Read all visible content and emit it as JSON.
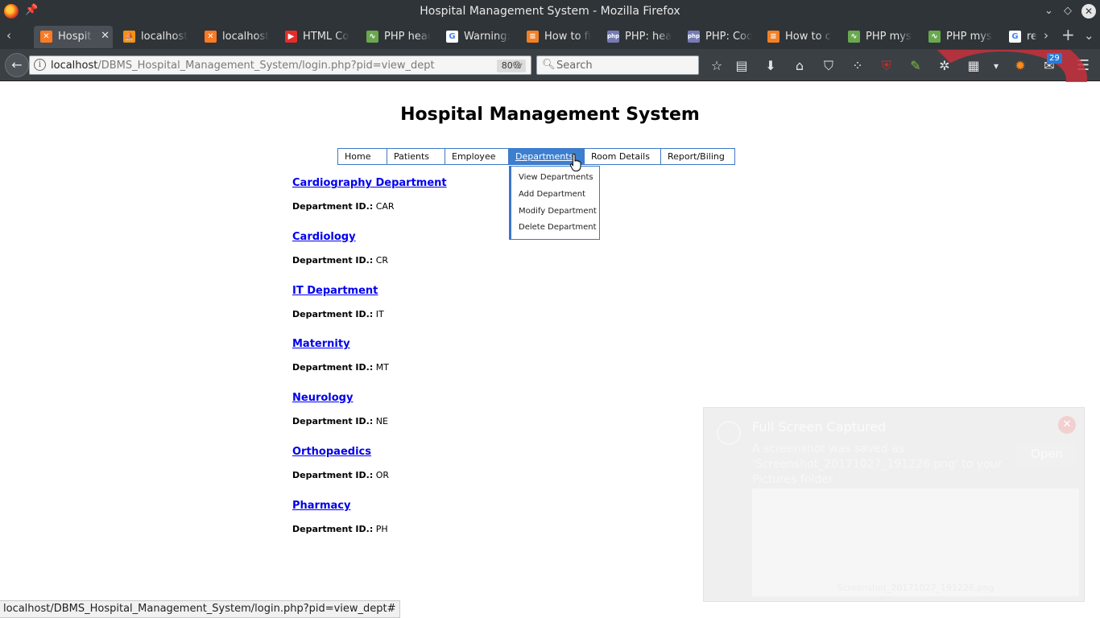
{
  "window": {
    "title": "Hospital Management System - Mozilla Firefox"
  },
  "tabs": [
    {
      "label": "Hospit",
      "icon": "xampp-icon",
      "active": true
    },
    {
      "label": "localhost",
      "icon": "phpmyadmin-icon"
    },
    {
      "label": "localhost/",
      "icon": "xampp-icon"
    },
    {
      "label": "HTML Col",
      "icon": "youtube-icon"
    },
    {
      "label": "PHP head",
      "icon": "chart-icon"
    },
    {
      "label": "Warning:",
      "icon": "google-icon"
    },
    {
      "label": "How to fi",
      "icon": "stackoverflow-icon"
    },
    {
      "label": "PHP: head",
      "icon": "php-icon"
    },
    {
      "label": "PHP: Coo",
      "icon": "php-icon"
    },
    {
      "label": "How to ch",
      "icon": "stackoverflow-icon"
    },
    {
      "label": "PHP mysq",
      "icon": "chart-icon"
    },
    {
      "label": "PHP mysq",
      "icon": "chart-icon"
    },
    {
      "label": "rec",
      "icon": "google-icon"
    }
  ],
  "navbar": {
    "url_host": "localhost",
    "url_path": "/DBMS_Hospital_Management_System/login.php?pid=view_dept",
    "zoom": "80%",
    "search_placeholder": "Search",
    "badge_count": "29"
  },
  "page": {
    "title": "Hospital Management System",
    "menu": [
      {
        "label": "Home",
        "active": false
      },
      {
        "label": "Patients",
        "active": false
      },
      {
        "label": "Employee",
        "active": false
      },
      {
        "label": "Departments",
        "active": true
      },
      {
        "label": "Room Details",
        "active": false
      },
      {
        "label": "Report/Biling",
        "active": false
      }
    ],
    "dropdown": [
      "View Departments",
      "Add Department",
      "Modify Department",
      "Delete Department"
    ],
    "departments": [
      {
        "name": "Cardiography Department",
        "id_label": "Department ID.:",
        "id": "CAR"
      },
      {
        "name": "Cardiology",
        "id_label": "Department ID.:",
        "id": "CR"
      },
      {
        "name": "IT Department",
        "id_label": "Department ID.:",
        "id": "IT"
      },
      {
        "name": "Maternity",
        "id_label": "Department ID.:",
        "id": "MT"
      },
      {
        "name": "Neurology",
        "id_label": "Department ID.:",
        "id": "NE"
      },
      {
        "name": "Orthopaedics",
        "id_label": "Department ID.:",
        "id": "OR"
      },
      {
        "name": "Pharmacy",
        "id_label": "Department ID.:",
        "id": "PH"
      }
    ]
  },
  "notification": {
    "title": "Full Screen Captured",
    "body": "A screenshot was saved as 'Screenshot_20171027_191226.png' to your Pictures folder.",
    "open_label": "Open",
    "file_label": "Screenshot_20171027_191226.png"
  },
  "statusbar": {
    "text": "localhost/DBMS_Hospital_Management_System/login.php?pid=view_dept#"
  },
  "colors": {
    "menu_border": "#3c78c8",
    "menu_active": "#3c7fd0",
    "link": "#0000ee",
    "chrome_dark": "#2f3438"
  }
}
